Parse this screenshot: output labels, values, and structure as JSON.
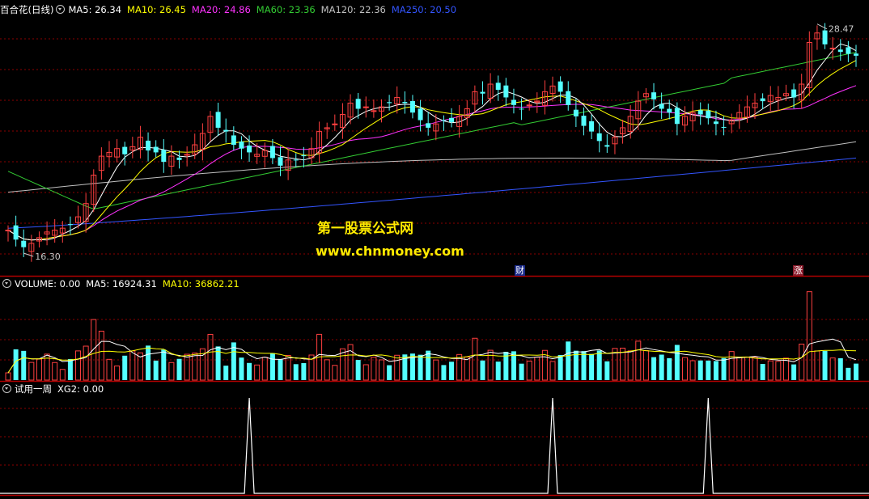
{
  "window": {
    "title": "百合花(日线)"
  },
  "colors": {
    "up": "#ff4040",
    "down": "#54ffff",
    "ma5": "#ffffff",
    "ma10": "#ffff00",
    "ma20": "#ff33ff",
    "ma60": "#33cc33",
    "ma120": "#c0c0c0",
    "ma250": "#3355ff",
    "grid": "#8b0000",
    "divider": "#b00000"
  },
  "price_panel": {
    "indicators": [
      {
        "label": "MA5: 26.34",
        "color": "#ffffff"
      },
      {
        "label": "MA10: 26.45",
        "color": "#ffff00"
      },
      {
        "label": "MA20: 24.86",
        "color": "#ff33ff"
      },
      {
        "label": "MA60: 23.36",
        "color": "#33cc33"
      },
      {
        "label": "MA120: 22.36",
        "color": "#c0c0c0"
      },
      {
        "label": "MA250: 20.50",
        "color": "#3355ff"
      }
    ],
    "high_label": "28.47",
    "low_label": "16.30",
    "badge_cai": "财",
    "badge_zhang": "涨"
  },
  "volume_panel": {
    "indicators": [
      {
        "label": "VOLUME: 0.00",
        "color": "#ffffff"
      },
      {
        "label": "MA5: 16924.31",
        "color": "#ffffff"
      },
      {
        "label": "MA10: 36862.21",
        "color": "#ffff00"
      }
    ]
  },
  "signal_panel": {
    "indicators": [
      {
        "label": "试用一周",
        "color": "#ffffff"
      },
      {
        "label": "XG2: 0.00",
        "color": "#ffffff"
      }
    ]
  },
  "watermark": {
    "line1": "第一股票公式网",
    "line2": "www.chnmoney.com"
  },
  "chart_data": {
    "type": "candlestick",
    "price_range": [
      16.3,
      28.47
    ],
    "annotated_high": 28.47,
    "annotated_low": 16.3,
    "ma_latest": {
      "MA5": 26.34,
      "MA10": 26.45,
      "MA20": 24.86,
      "MA60": 23.36,
      "MA120": 22.36,
      "MA250": 20.5
    },
    "volume_latest": {
      "VOLUME": 0.0,
      "MA5": 16924.31,
      "MA10": 36862.21
    },
    "signal_latest": {
      "XG2": 0.0
    },
    "closes": [
      17.6,
      17.1,
      16.7,
      16.9,
      17.2,
      17.5,
      17.6,
      17.7,
      17.9,
      18.3,
      19.0,
      20.5,
      21.5,
      21.7,
      21.9,
      21.6,
      22.0,
      22.5,
      21.8,
      21.7,
      21.2,
      21.5,
      21.3,
      21.6,
      22.1,
      22.7,
      23.6,
      23.0,
      22.8,
      22.1,
      21.9,
      21.7,
      21.6,
      21.8,
      21.4,
      21.0,
      21.3,
      21.3,
      21.5,
      21.9,
      22.8,
      23.0,
      23.2,
      23.7,
      24.3,
      24.0,
      24.1,
      23.9,
      24.1,
      24.3,
      24.6,
      24.3,
      23.8,
      23.4,
      23.0,
      23.2,
      23.4,
      23.3,
      23.6,
      24.0,
      24.9,
      24.8,
      25.3,
      25.0,
      24.6,
      24.2,
      24.0,
      24.2,
      24.4,
      24.9,
      25.2,
      24.9,
      24.2,
      23.6,
      23.1,
      22.8,
      22.3,
      22.0,
      22.5,
      23.0,
      23.6,
      24.4,
      24.8,
      24.5,
      24.0,
      23.8,
      23.2,
      23.6,
      23.8,
      23.7,
      23.5,
      23.2,
      23.0,
      23.4,
      23.8,
      24.1,
      24.3,
      24.4,
      24.7,
      24.6,
      24.8,
      24.6,
      25.3,
      27.5,
      28.0,
      27.4,
      27.2,
      27.0,
      26.9,
      26.8
    ],
    "signal_peaks_index": [
      31,
      70,
      90
    ]
  }
}
